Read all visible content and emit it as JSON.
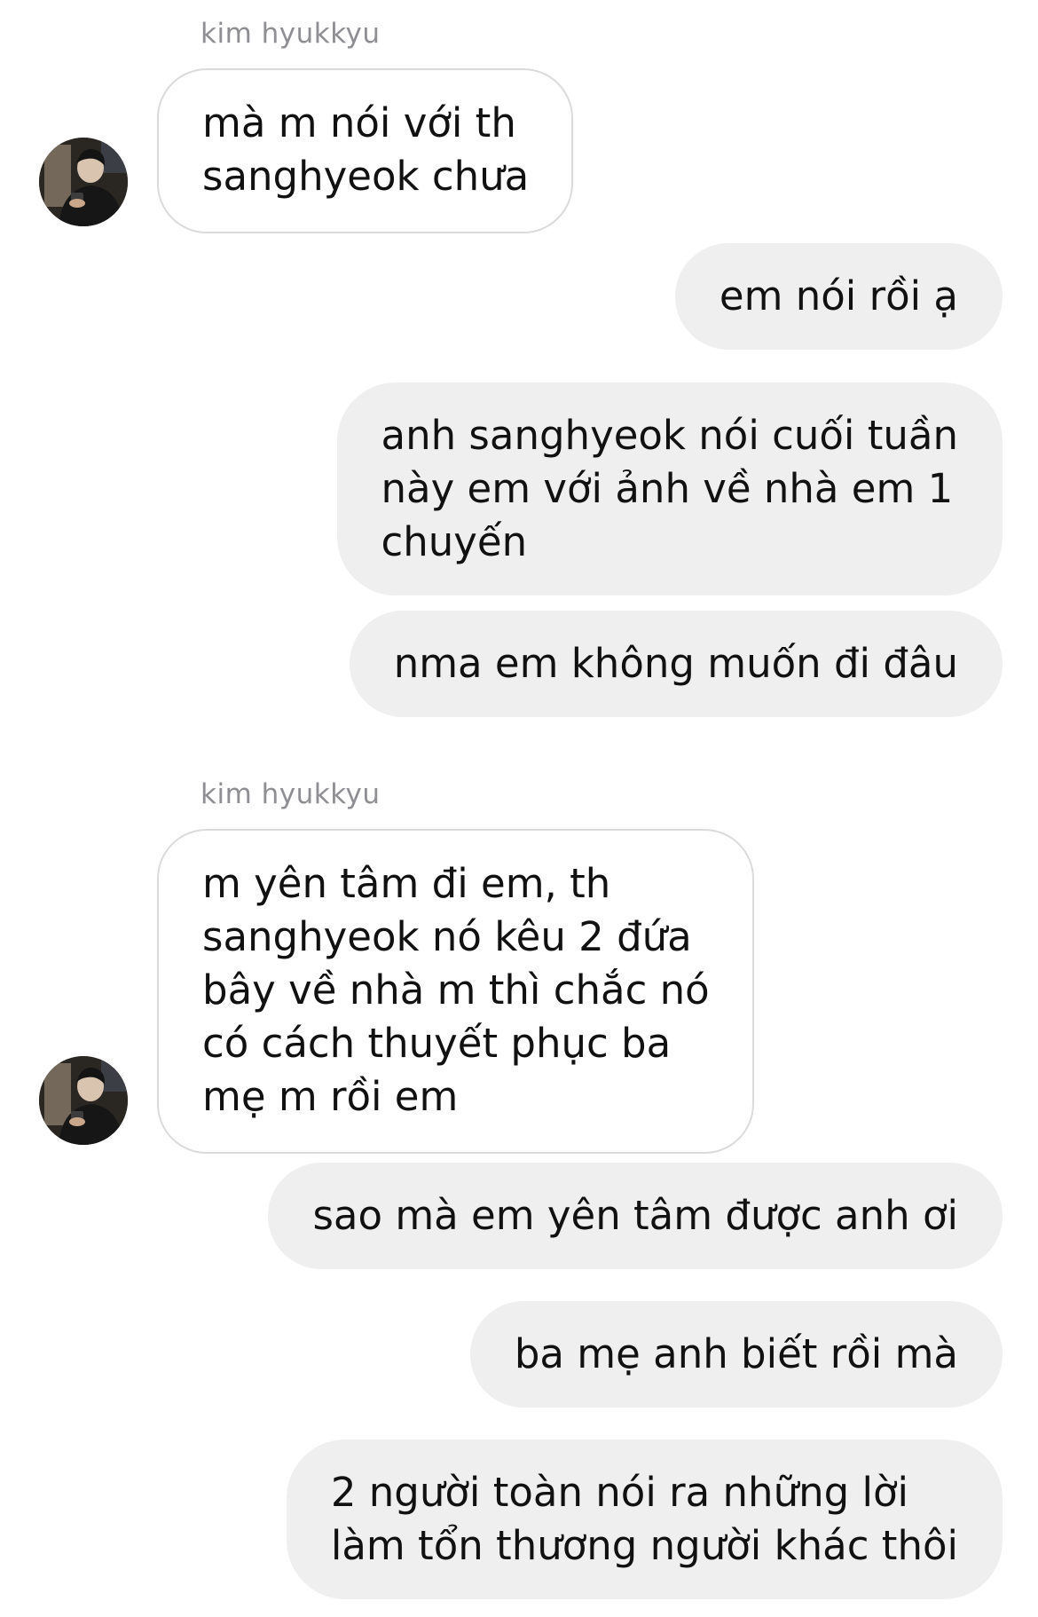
{
  "conversation": {
    "contact_name": "kim hyukkyu",
    "groups": [
      {
        "sender": "kim hyukkyu",
        "avatar_icon": "profile-photo-avatar",
        "messages": [
          "mà m nói với th\nsanghyeok chưa"
        ]
      },
      {
        "sender": "me",
        "messages": [
          "em nói rồi ạ",
          "anh sanghyeok nói cuối tuần\nnày em với ảnh về nhà em 1\nchuyến",
          "nma em không muốn đi đâu"
        ]
      },
      {
        "sender": "kim hyukkyu",
        "avatar_icon": "profile-photo-avatar",
        "messages": [
          "m yên tâm đi em, th\nsanghyeok nó kêu 2 đứa\nbây về nhà m thì chắc nó\ncó cách thuyết phục ba\nmẹ m rồi em"
        ]
      },
      {
        "sender": "me",
        "messages": [
          "sao mà em yên tâm được anh ơi",
          "ba mẹ anh biết rồi mà",
          "2 người toàn nói ra những lời\nlàm tổn thương người khác thôi"
        ]
      }
    ]
  },
  "colors": {
    "incoming_bubble_bg": "#ffffff",
    "incoming_bubble_border": "#dbdbdb",
    "outgoing_bubble_bg": "#efefef",
    "sender_name_text": "#8e8e93",
    "message_text": "#111111"
  }
}
